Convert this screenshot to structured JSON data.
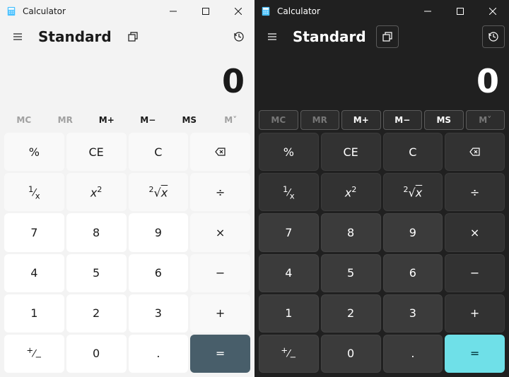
{
  "light": {
    "title": "Calculator",
    "mode": "Standard",
    "display": "0",
    "accent": "#485e6a",
    "memory": [
      "MC",
      "MR",
      "M+",
      "M−",
      "MS",
      "M˅"
    ],
    "memory_disabled": [
      true,
      true,
      false,
      false,
      false,
      true
    ],
    "buttons": {
      "percent": "%",
      "clear_entry": "CE",
      "clear": "C",
      "backspace": "⌫",
      "reciprocal": "¹⁄ₓ",
      "square": "x²",
      "sqrt": "²√x",
      "divide": "÷",
      "d7": "7",
      "d8": "8",
      "d9": "9",
      "multiply": "×",
      "d4": "4",
      "d5": "5",
      "d6": "6",
      "minus": "−",
      "d1": "1",
      "d2": "2",
      "d3": "3",
      "plus": "+",
      "negate": "⁺⁄₋",
      "d0": "0",
      "decimal": ".",
      "equals": "="
    }
  },
  "dark": {
    "title": "Calculator",
    "mode": "Standard",
    "display": "0",
    "accent": "#6fe0e8",
    "memory": [
      "MC",
      "MR",
      "M+",
      "M−",
      "MS",
      "M˅"
    ],
    "memory_disabled": [
      true,
      true,
      false,
      false,
      false,
      true
    ],
    "buttons": {
      "percent": "%",
      "clear_entry": "CE",
      "clear": "C",
      "backspace": "⌫",
      "reciprocal": "¹⁄ₓ",
      "square": "x²",
      "sqrt": "²√x",
      "divide": "÷",
      "d7": "7",
      "d8": "8",
      "d9": "9",
      "multiply": "×",
      "d4": "4",
      "d5": "5",
      "d6": "6",
      "minus": "−",
      "d1": "1",
      "d2": "2",
      "d3": "3",
      "plus": "+",
      "negate": "⁺⁄₋",
      "d0": "0",
      "decimal": ".",
      "equals": "="
    }
  }
}
